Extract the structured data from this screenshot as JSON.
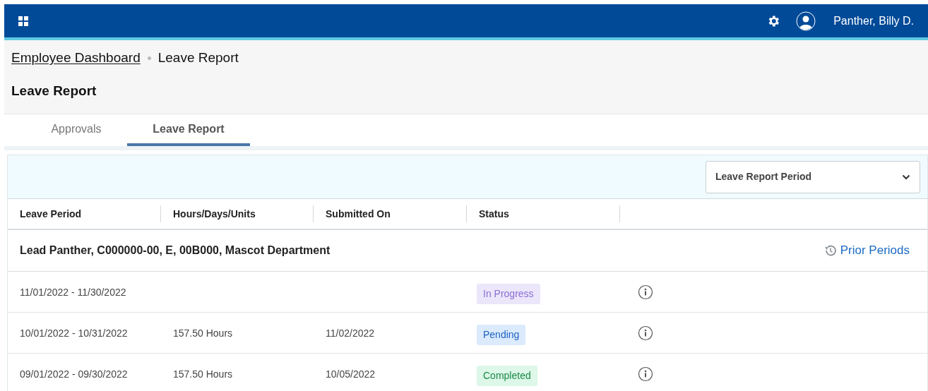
{
  "top_bar": {
    "user_name": "Panther, Billy D."
  },
  "breadcrumb": [
    {
      "label": "Employee Dashboard",
      "kind": "link"
    },
    {
      "label": "Leave Report",
      "kind": "current"
    }
  ],
  "page_title": "Leave Report",
  "tabs": [
    {
      "label": "Approvals",
      "selected": false
    },
    {
      "label": "Leave Report",
      "selected": true
    }
  ],
  "period_select": {
    "value": "Leave Report Period"
  },
  "table": {
    "columns": [
      "Leave Period",
      "Hours/Days/Units",
      "Submitted On",
      "Status"
    ],
    "group": {
      "label": "Lead Panther, C000000-00, E, 00B000, Mascot Department",
      "link": "Prior Periods"
    },
    "rows": [
      {
        "period": "11/01/2022 - 11/30/2022",
        "status": "In Progress",
        "kind": "in_progress"
      },
      {
        "period": "10/01/2022 - 10/31/2022",
        "hours": "157.50 Hours",
        "submitted": "11/02/2022",
        "status": "Pending",
        "kind": "pending"
      },
      {
        "period": "09/01/2022 - 09/30/2022",
        "hours": "157.50 Hours",
        "submitted": "10/05/2022",
        "status": "Completed",
        "kind": "completed"
      }
    ]
  }
}
